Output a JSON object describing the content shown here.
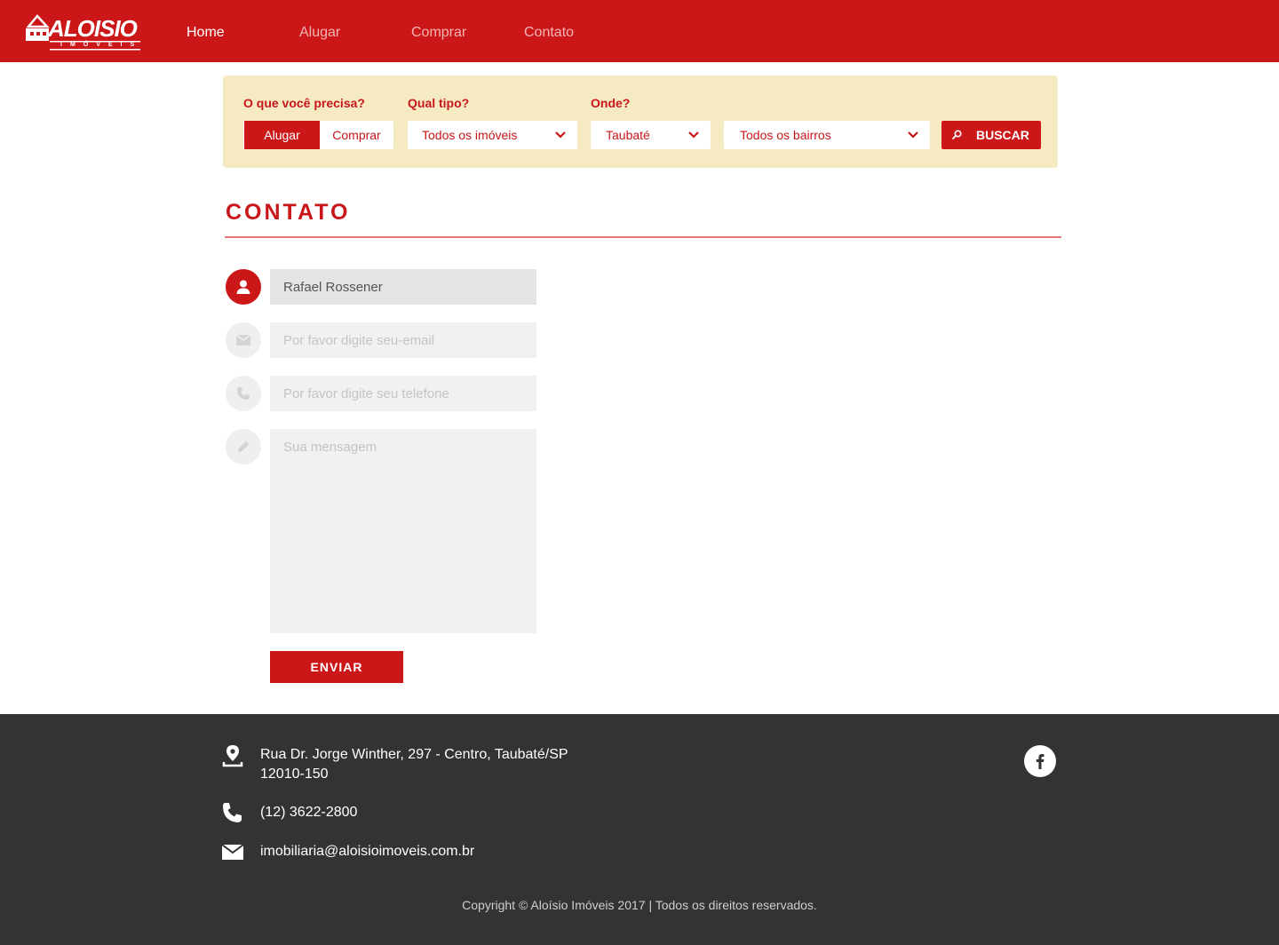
{
  "brand": {
    "name": "ALOISIO",
    "tagline": "IMÓVEIS",
    "primary_color": "#cc1719",
    "panel_color": "#f6eac3",
    "footer_color": "#333333"
  },
  "nav": {
    "items": [
      {
        "label": "Home",
        "active": true
      },
      {
        "label": "Alugar",
        "active": false
      },
      {
        "label": "Comprar",
        "active": false
      },
      {
        "label": "Contato",
        "active": false
      }
    ]
  },
  "search": {
    "need_label": "O que você precisa?",
    "type_label": "Qual tipo?",
    "where_label": "Onde?",
    "toggle": {
      "selected": "Alugar",
      "other": "Comprar"
    },
    "type_value": "Todos os imóveis",
    "city_value": "Taubaté",
    "district_value": "Todos os bairros",
    "button_label": "BUSCAR",
    "button_icon": "search-icon"
  },
  "page": {
    "title": "CONTATO"
  },
  "form": {
    "name_value": "Rafael Rossener",
    "email_placeholder": "Por favor digite seu-email",
    "phone_placeholder": "Por favor digite seu telefone",
    "message_placeholder": "Sua mensagem",
    "submit_label": "ENVIAR",
    "icons": [
      "user-icon",
      "envelope-icon",
      "phone-icon",
      "pencil-icon"
    ]
  },
  "footer": {
    "address_line1": "Rua Dr. Jorge Winther, 297 - Centro, Taubaté/SP",
    "address_line2": "12010-150",
    "phone": "(12) 3622-2800",
    "email": "imobiliaria@aloisioimoveis.com.br",
    "social_icon": "facebook-icon",
    "copyright": "Copyright © Aloísio Imóveis 2017 | Todos os direitos reservados."
  }
}
